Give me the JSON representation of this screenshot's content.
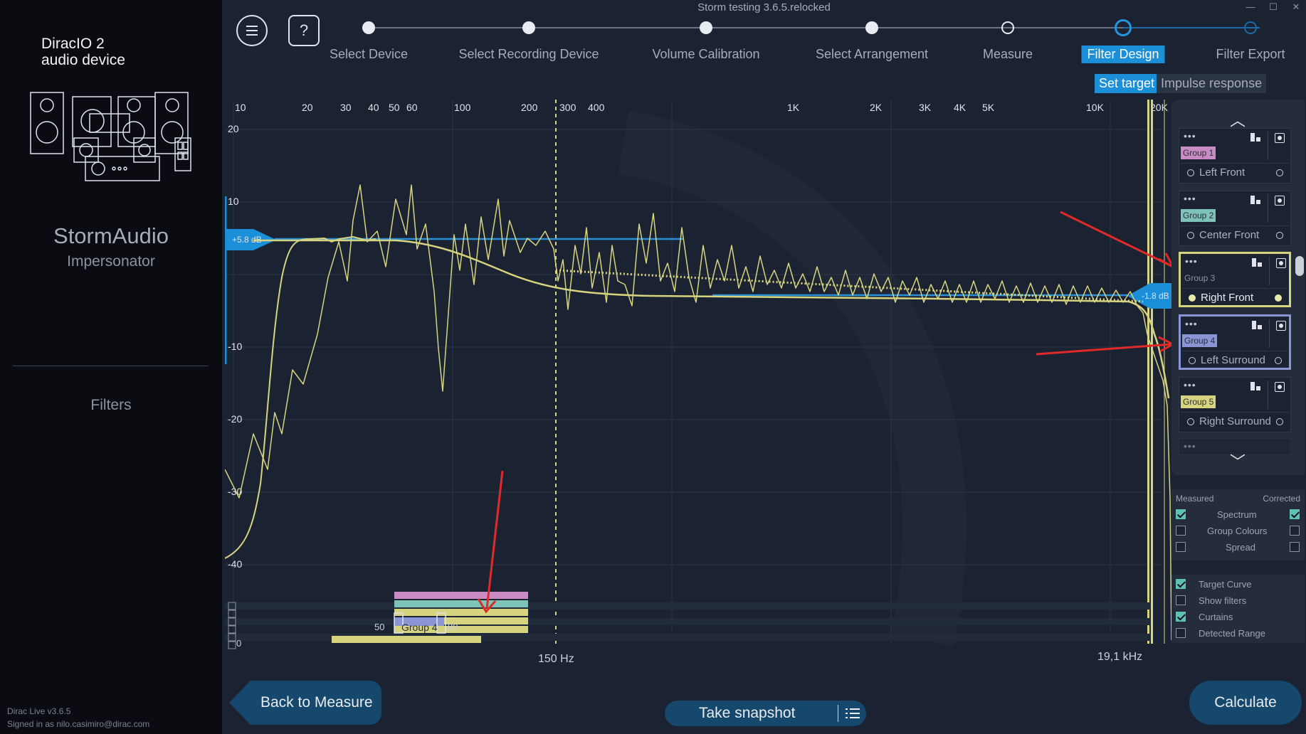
{
  "sidebar": {
    "device_line1": "DiracIO 2",
    "device_line2": "audio device",
    "vendor": "StormAudio",
    "model": "Impersonator",
    "section": "Filters",
    "version": "Dirac Live v3.6.5",
    "signed_in": "Signed in as nilo.casimiro@dirac.com"
  },
  "window": {
    "title": "Storm testing 3.6.5.relocked",
    "controls": [
      "—",
      "☐",
      "✕"
    ]
  },
  "toolbar": {
    "help": "?"
  },
  "stepper": {
    "steps": [
      "Select Device",
      "Select Recording Device",
      "Volume Calibration",
      "Select Arrangement",
      "Measure",
      "Filter Design",
      "Filter Export"
    ],
    "active_step": "Filter Design"
  },
  "subtabs": {
    "set_target": "Set target",
    "impulse_response": "Impulse response"
  },
  "plot": {
    "freq_ticks": [
      "10",
      "20",
      "30",
      "40",
      "50",
      "60",
      "100",
      "200",
      "300",
      "400",
      "1K",
      "2K",
      "3K",
      "4K",
      "5K",
      "10K",
      "20K"
    ],
    "db_ticks": [
      "20",
      "10",
      "-10",
      "-20",
      "-30",
      "-40"
    ],
    "left_handle": "+5.8 dB",
    "right_handle": "-1.8 dB",
    "low_curtain_label": "150 Hz",
    "high_curtain_label": "19,1 kHz",
    "crossover_group_label": "Group 4",
    "crossover_low": "50",
    "crossover_high": "80",
    "crossover_zero": "0"
  },
  "groups": [
    {
      "tag": "Group 1",
      "channel": "Left Front",
      "color": "#c98bc4"
    },
    {
      "tag": "Group 2",
      "channel": "Center Front",
      "color": "#7ec3b7"
    },
    {
      "tag": "Group 3",
      "channel": "Right Front",
      "color": "#d7d480"
    },
    {
      "tag": "Group 4",
      "channel": "Left Surround",
      "color": "#8a95d6"
    },
    {
      "tag": "Group 5",
      "channel": "Right Surround",
      "color": "#d7d480"
    }
  ],
  "display_options": {
    "measured": "Measured",
    "corrected": "Corrected",
    "spectrum": "Spectrum",
    "group_colours": "Group Colours",
    "spread": "Spread",
    "target_curve": "Target Curve",
    "show_filters": "Show filters",
    "curtains": "Curtains",
    "detected_range": "Detected Range"
  },
  "buttons": {
    "back": "Back to Measure",
    "snapshot": "Take snapshot",
    "calculate": "Calculate"
  },
  "colors": {
    "accent": "#1c8fd9",
    "target_curve": "#2a8fd6",
    "measurement": "#d7d480",
    "button": "#16486d"
  }
}
